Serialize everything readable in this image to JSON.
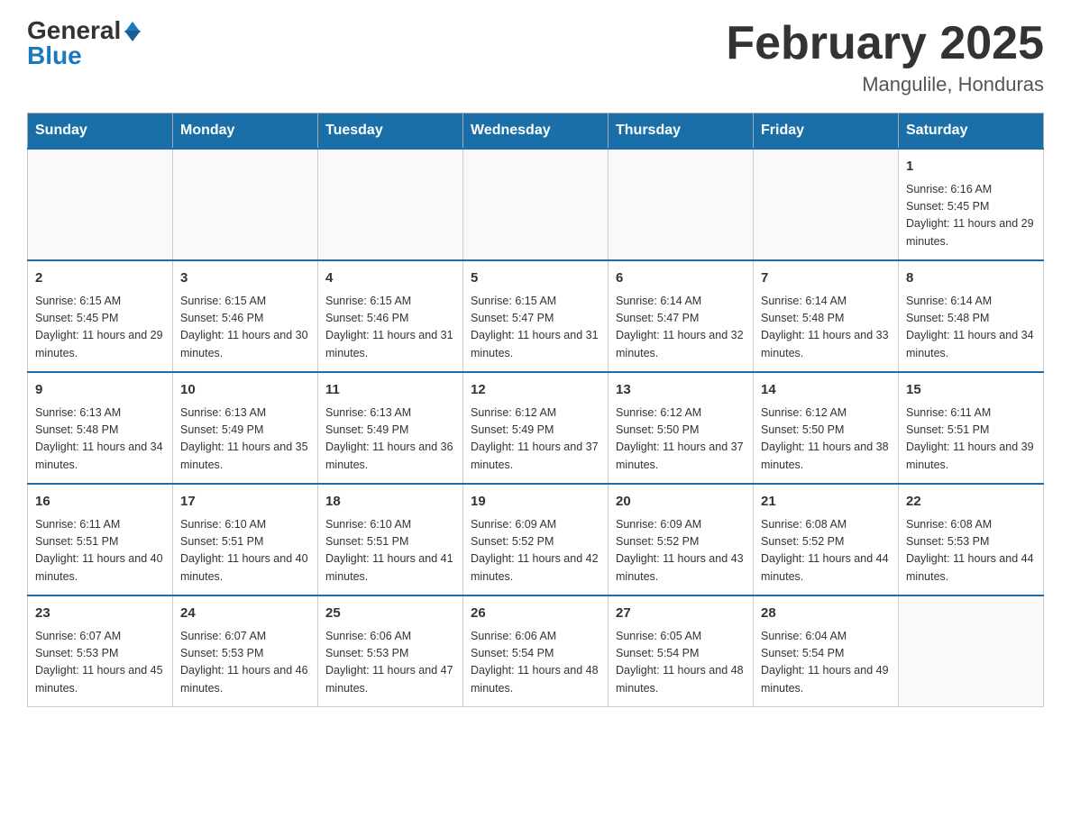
{
  "header": {
    "logo_general": "General",
    "logo_blue": "Blue",
    "month_title": "February 2025",
    "location": "Mangulile, Honduras"
  },
  "weekdays": [
    "Sunday",
    "Monday",
    "Tuesday",
    "Wednesday",
    "Thursday",
    "Friday",
    "Saturday"
  ],
  "weeks": [
    [
      {
        "day": "",
        "info": ""
      },
      {
        "day": "",
        "info": ""
      },
      {
        "day": "",
        "info": ""
      },
      {
        "day": "",
        "info": ""
      },
      {
        "day": "",
        "info": ""
      },
      {
        "day": "",
        "info": ""
      },
      {
        "day": "1",
        "info": "Sunrise: 6:16 AM\nSunset: 5:45 PM\nDaylight: 11 hours and 29 minutes."
      }
    ],
    [
      {
        "day": "2",
        "info": "Sunrise: 6:15 AM\nSunset: 5:45 PM\nDaylight: 11 hours and 29 minutes."
      },
      {
        "day": "3",
        "info": "Sunrise: 6:15 AM\nSunset: 5:46 PM\nDaylight: 11 hours and 30 minutes."
      },
      {
        "day": "4",
        "info": "Sunrise: 6:15 AM\nSunset: 5:46 PM\nDaylight: 11 hours and 31 minutes."
      },
      {
        "day": "5",
        "info": "Sunrise: 6:15 AM\nSunset: 5:47 PM\nDaylight: 11 hours and 31 minutes."
      },
      {
        "day": "6",
        "info": "Sunrise: 6:14 AM\nSunset: 5:47 PM\nDaylight: 11 hours and 32 minutes."
      },
      {
        "day": "7",
        "info": "Sunrise: 6:14 AM\nSunset: 5:48 PM\nDaylight: 11 hours and 33 minutes."
      },
      {
        "day": "8",
        "info": "Sunrise: 6:14 AM\nSunset: 5:48 PM\nDaylight: 11 hours and 34 minutes."
      }
    ],
    [
      {
        "day": "9",
        "info": "Sunrise: 6:13 AM\nSunset: 5:48 PM\nDaylight: 11 hours and 34 minutes."
      },
      {
        "day": "10",
        "info": "Sunrise: 6:13 AM\nSunset: 5:49 PM\nDaylight: 11 hours and 35 minutes."
      },
      {
        "day": "11",
        "info": "Sunrise: 6:13 AM\nSunset: 5:49 PM\nDaylight: 11 hours and 36 minutes."
      },
      {
        "day": "12",
        "info": "Sunrise: 6:12 AM\nSunset: 5:49 PM\nDaylight: 11 hours and 37 minutes."
      },
      {
        "day": "13",
        "info": "Sunrise: 6:12 AM\nSunset: 5:50 PM\nDaylight: 11 hours and 37 minutes."
      },
      {
        "day": "14",
        "info": "Sunrise: 6:12 AM\nSunset: 5:50 PM\nDaylight: 11 hours and 38 minutes."
      },
      {
        "day": "15",
        "info": "Sunrise: 6:11 AM\nSunset: 5:51 PM\nDaylight: 11 hours and 39 minutes."
      }
    ],
    [
      {
        "day": "16",
        "info": "Sunrise: 6:11 AM\nSunset: 5:51 PM\nDaylight: 11 hours and 40 minutes."
      },
      {
        "day": "17",
        "info": "Sunrise: 6:10 AM\nSunset: 5:51 PM\nDaylight: 11 hours and 40 minutes."
      },
      {
        "day": "18",
        "info": "Sunrise: 6:10 AM\nSunset: 5:51 PM\nDaylight: 11 hours and 41 minutes."
      },
      {
        "day": "19",
        "info": "Sunrise: 6:09 AM\nSunset: 5:52 PM\nDaylight: 11 hours and 42 minutes."
      },
      {
        "day": "20",
        "info": "Sunrise: 6:09 AM\nSunset: 5:52 PM\nDaylight: 11 hours and 43 minutes."
      },
      {
        "day": "21",
        "info": "Sunrise: 6:08 AM\nSunset: 5:52 PM\nDaylight: 11 hours and 44 minutes."
      },
      {
        "day": "22",
        "info": "Sunrise: 6:08 AM\nSunset: 5:53 PM\nDaylight: 11 hours and 44 minutes."
      }
    ],
    [
      {
        "day": "23",
        "info": "Sunrise: 6:07 AM\nSunset: 5:53 PM\nDaylight: 11 hours and 45 minutes."
      },
      {
        "day": "24",
        "info": "Sunrise: 6:07 AM\nSunset: 5:53 PM\nDaylight: 11 hours and 46 minutes."
      },
      {
        "day": "25",
        "info": "Sunrise: 6:06 AM\nSunset: 5:53 PM\nDaylight: 11 hours and 47 minutes."
      },
      {
        "day": "26",
        "info": "Sunrise: 6:06 AM\nSunset: 5:54 PM\nDaylight: 11 hours and 48 minutes."
      },
      {
        "day": "27",
        "info": "Sunrise: 6:05 AM\nSunset: 5:54 PM\nDaylight: 11 hours and 48 minutes."
      },
      {
        "day": "28",
        "info": "Sunrise: 6:04 AM\nSunset: 5:54 PM\nDaylight: 11 hours and 49 minutes."
      },
      {
        "day": "",
        "info": ""
      }
    ]
  ]
}
